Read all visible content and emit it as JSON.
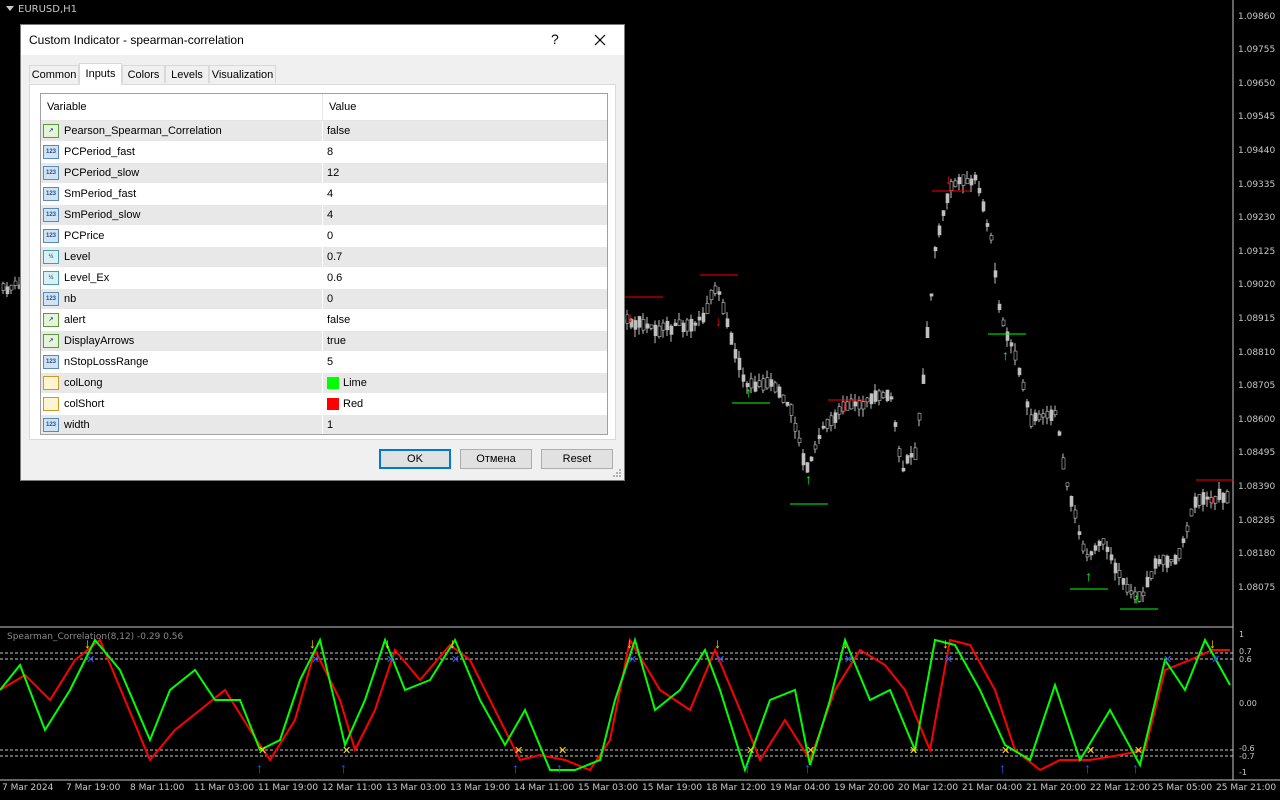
{
  "chart": {
    "symbol_title": "EURUSD,H1",
    "indicator_title": "Spearman_Correlation(8,12) -0.29 0.56",
    "price_labels": [
      "1.09860",
      "1.09755",
      "1.09650",
      "1.09545",
      "1.09440",
      "1.09335",
      "1.09230",
      "1.09125",
      "1.09020",
      "1.08915",
      "1.08810",
      "1.08705",
      "1.08600",
      "1.08495",
      "1.08390",
      "1.08285",
      "1.08180",
      "1.08075"
    ],
    "indicator_levels": [
      "1",
      "0.7",
      "0.6",
      "0.00",
      "-0.6",
      "-0.7",
      "-1"
    ],
    "time_labels": [
      "7 Mar 2024",
      "7 Mar 19:00",
      "8 Mar 11:00",
      "11 Mar 03:00",
      "11 Mar 19:00",
      "12 Mar 11:00",
      "13 Mar 03:00",
      "13 Mar 19:00",
      "14 Mar 11:00",
      "15 Mar 03:00",
      "15 Mar 19:00",
      "18 Mar 12:00",
      "19 Mar 04:00",
      "19 Mar 20:00",
      "20 Mar 12:00",
      "21 Mar 04:00",
      "21 Mar 20:00",
      "22 Mar 12:00",
      "25 Mar 05:00",
      "25 Mar 21:00"
    ],
    "colors": {
      "background": "#000000",
      "candle": "#c0c0c0",
      "long": "#00ff00",
      "short": "#ff0000",
      "up_arrow": "#2a5cff",
      "down_arrow": "#ffd700"
    }
  },
  "dialog": {
    "title": "Custom Indicator - spearman-correlation",
    "help_label": "?",
    "tabs": [
      {
        "label": "Common"
      },
      {
        "label": "Inputs"
      },
      {
        "label": "Colors"
      },
      {
        "label": "Levels"
      },
      {
        "label": "Visualization"
      }
    ],
    "active_tab": "Inputs",
    "columns": {
      "variable": "Variable",
      "value": "Value"
    },
    "rows": [
      {
        "icon": "bool-icon",
        "variable": "Pearson_Spearman_Correlation",
        "value": "false"
      },
      {
        "icon": "int-icon",
        "variable": "PCPeriod_fast",
        "value": "8"
      },
      {
        "icon": "int-icon",
        "variable": "PCPeriod_slow",
        "value": "12"
      },
      {
        "icon": "int-icon",
        "variable": "SmPeriod_fast",
        "value": "4"
      },
      {
        "icon": "int-icon",
        "variable": "SmPeriod_slow",
        "value": "4"
      },
      {
        "icon": "int-icon",
        "variable": "PCPrice",
        "value": "0"
      },
      {
        "icon": "double-icon",
        "variable": "Level",
        "value": "0.7"
      },
      {
        "icon": "double-icon",
        "variable": "Level_Ex",
        "value": "0.6"
      },
      {
        "icon": "int-icon",
        "variable": "nb",
        "value": "0"
      },
      {
        "icon": "bool-icon",
        "variable": "alert",
        "value": "false"
      },
      {
        "icon": "bool-icon",
        "variable": "DisplayArrows",
        "value": "true"
      },
      {
        "icon": "int-icon",
        "variable": "nStopLossRange",
        "value": "5"
      },
      {
        "icon": "color-icon",
        "variable": "colLong",
        "value": "Lime",
        "swatch": "#00ff00"
      },
      {
        "icon": "color-icon",
        "variable": "colShort",
        "value": "Red",
        "swatch": "#ff0000"
      },
      {
        "icon": "int-icon",
        "variable": "width",
        "value": "1"
      }
    ],
    "buttons": {
      "ok": "OK",
      "cancel": "Отмена",
      "reset": "Reset"
    }
  }
}
